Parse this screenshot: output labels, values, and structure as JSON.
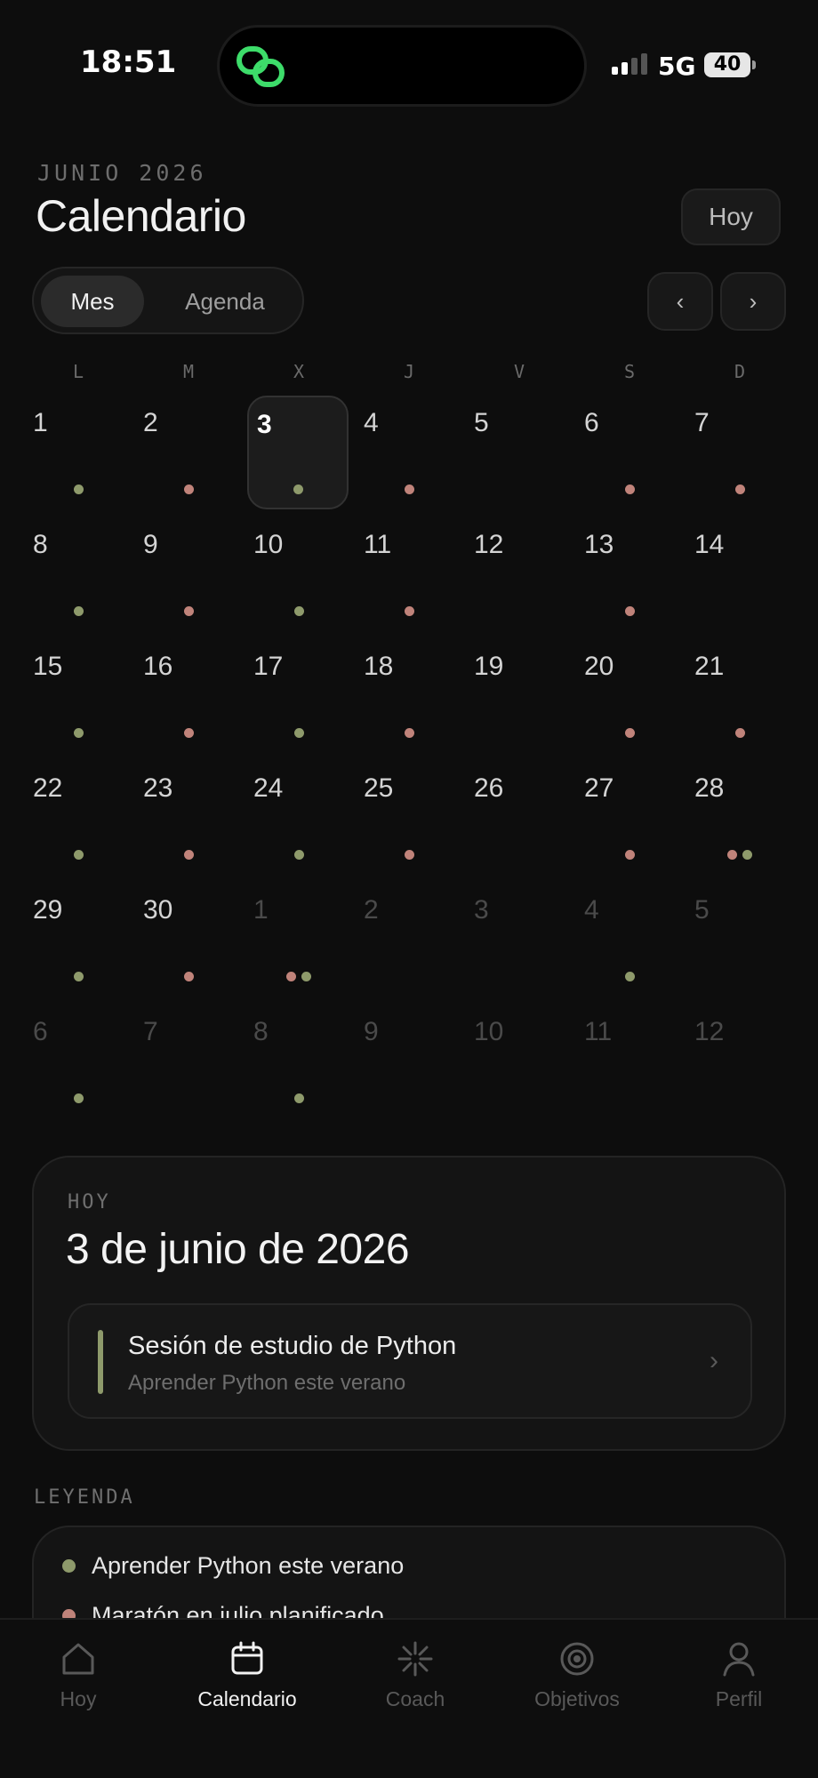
{
  "status_bar": {
    "time": "18:51",
    "network": "5G",
    "battery": "40"
  },
  "header": {
    "month_label": "JUNIO 2026",
    "title": "Calendario",
    "today_button": "Hoy"
  },
  "view_toggle": {
    "options": [
      "Mes",
      "Agenda"
    ],
    "selected": "Mes"
  },
  "nav": {
    "prev": "‹",
    "next": "›"
  },
  "colors": {
    "python": "#8e9a6b",
    "marathon": "#c0837a",
    "background": "#0d0d0d"
  },
  "calendar": {
    "weekdays": [
      "L",
      "M",
      "X",
      "J",
      "V",
      "S",
      "D"
    ],
    "weeks": [
      [
        {
          "day": "1",
          "dots": [
            "python"
          ]
        },
        {
          "day": "2",
          "dots": [
            "marathon"
          ]
        },
        {
          "day": "3",
          "today": true,
          "dots": [
            "python"
          ]
        },
        {
          "day": "4",
          "dots": [
            "marathon"
          ]
        },
        {
          "day": "5",
          "dots": []
        },
        {
          "day": "6",
          "dots": [
            "marathon"
          ]
        },
        {
          "day": "7",
          "dots": [
            "marathon"
          ]
        }
      ],
      [
        {
          "day": "8",
          "dots": [
            "python"
          ]
        },
        {
          "day": "9",
          "dots": [
            "marathon"
          ]
        },
        {
          "day": "10",
          "dots": [
            "python"
          ]
        },
        {
          "day": "11",
          "dots": [
            "marathon"
          ]
        },
        {
          "day": "12",
          "dots": []
        },
        {
          "day": "13",
          "dots": [
            "marathon"
          ]
        },
        {
          "day": "14",
          "dots": []
        }
      ],
      [
        {
          "day": "15",
          "dots": [
            "python"
          ]
        },
        {
          "day": "16",
          "dots": [
            "marathon"
          ]
        },
        {
          "day": "17",
          "dots": [
            "python"
          ]
        },
        {
          "day": "18",
          "dots": [
            "marathon"
          ]
        },
        {
          "day": "19",
          "dots": []
        },
        {
          "day": "20",
          "dots": [
            "marathon"
          ]
        },
        {
          "day": "21",
          "dots": [
            "marathon"
          ]
        }
      ],
      [
        {
          "day": "22",
          "dots": [
            "python"
          ]
        },
        {
          "day": "23",
          "dots": [
            "marathon"
          ]
        },
        {
          "day": "24",
          "dots": [
            "python"
          ]
        },
        {
          "day": "25",
          "dots": [
            "marathon"
          ]
        },
        {
          "day": "26",
          "dots": []
        },
        {
          "day": "27",
          "dots": [
            "marathon"
          ]
        },
        {
          "day": "28",
          "dots": [
            "marathon",
            "python"
          ]
        }
      ],
      [
        {
          "day": "29",
          "dots": [
            "python"
          ]
        },
        {
          "day": "30",
          "dots": [
            "marathon"
          ]
        },
        {
          "day": "1",
          "other": true,
          "dots": [
            "marathon",
            "python"
          ]
        },
        {
          "day": "2",
          "other": true,
          "dots": []
        },
        {
          "day": "3",
          "other": true,
          "dots": []
        },
        {
          "day": "4",
          "other": true,
          "dots": [
            "python"
          ]
        },
        {
          "day": "5",
          "other": true,
          "dots": []
        }
      ],
      [
        {
          "day": "6",
          "other": true,
          "dots": [
            "python"
          ]
        },
        {
          "day": "7",
          "other": true,
          "dots": []
        },
        {
          "day": "8",
          "other": true,
          "dots": [
            "python"
          ]
        },
        {
          "day": "9",
          "other": true,
          "dots": []
        },
        {
          "day": "10",
          "other": true,
          "dots": []
        },
        {
          "day": "11",
          "other": true,
          "dots": []
        },
        {
          "day": "12",
          "other": true,
          "dots": []
        }
      ]
    ]
  },
  "today_card": {
    "label": "HOY",
    "date": "3 de junio de 2026",
    "event": {
      "title": "Sesión de estudio de Python",
      "subtitle": "Aprender Python este verano",
      "color": "python"
    }
  },
  "legend": {
    "label": "LEYENDA",
    "items": [
      {
        "label": "Aprender Python este verano",
        "color": "python"
      },
      {
        "label": "Maratón en julio planificado",
        "color": "marathon"
      }
    ]
  },
  "tabs": [
    {
      "label": "Hoy",
      "icon": "home-icon",
      "active": false
    },
    {
      "label": "Calendario",
      "icon": "calendar-icon",
      "active": true
    },
    {
      "label": "Coach",
      "icon": "sparkle-icon",
      "active": false
    },
    {
      "label": "Objetivos",
      "icon": "target-icon",
      "active": false
    },
    {
      "label": "Perfil",
      "icon": "person-icon",
      "active": false
    }
  ]
}
